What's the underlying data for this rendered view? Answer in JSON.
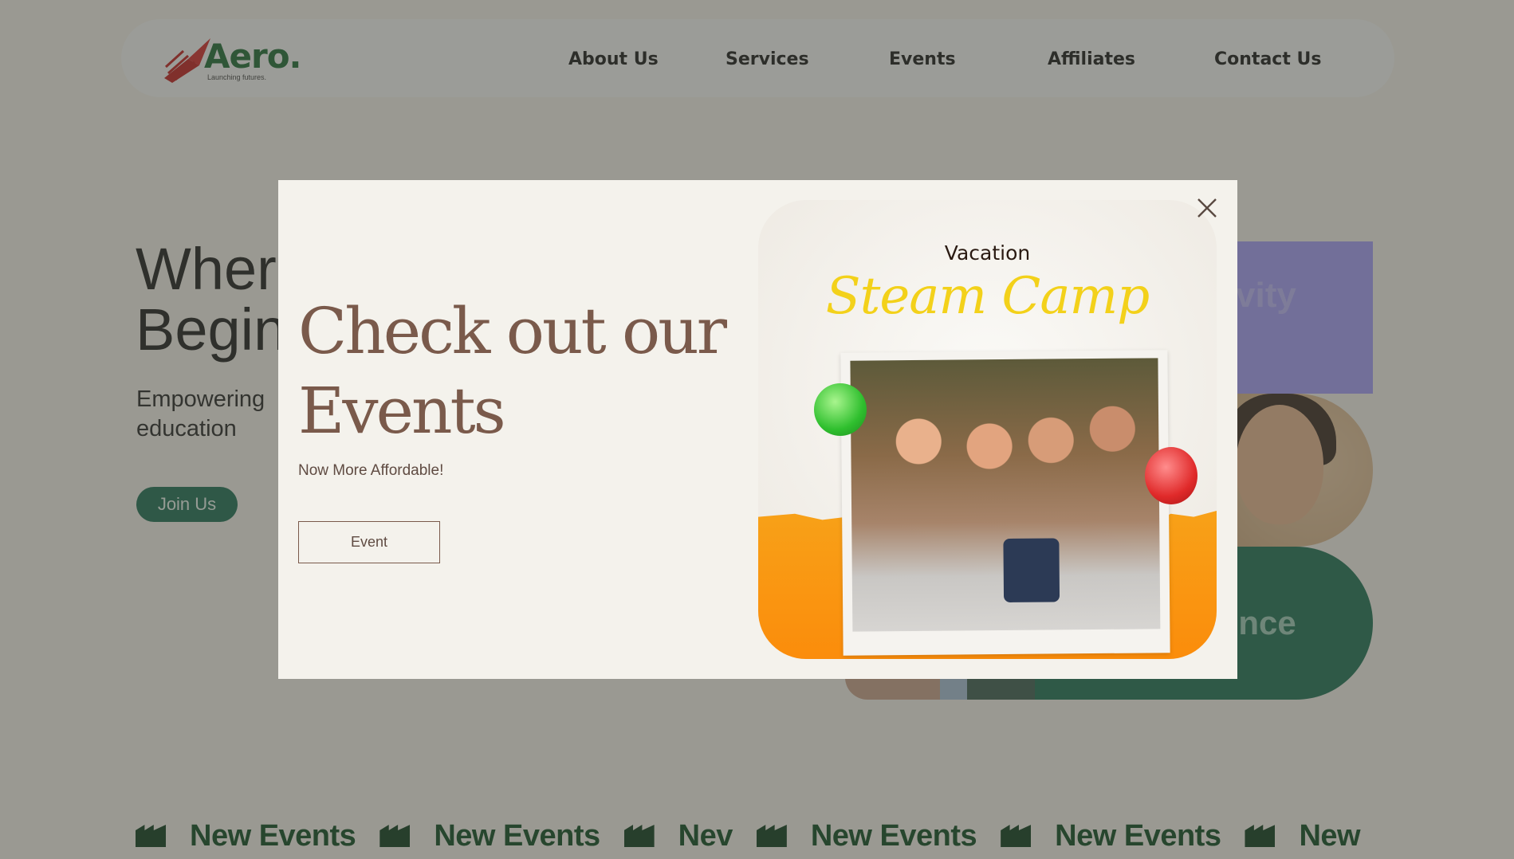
{
  "nav": {
    "logo_text": "Aero.",
    "logo_tagline": "Launching futures.",
    "links": [
      "About Us",
      "Services",
      "Events",
      "Affiliates",
      "Contact Us"
    ]
  },
  "hero": {
    "title_line1": "Where",
    "title_line2": "Begin",
    "subtitle_line1": "Empowering",
    "subtitle_line2": "education",
    "cta_label": "Join Us",
    "tile_purple_text": "vity",
    "tile_green_text": "ence"
  },
  "marquee": {
    "items": [
      "New Events",
      "New Events",
      "Nev",
      "New Events",
      "New Events",
      "New"
    ]
  },
  "modal": {
    "title_line1": "Check out our",
    "title_line2": "Events",
    "subtitle": "Now More Affordable!",
    "button_label": "Event",
    "poster": {
      "heading": "Vacation",
      "script_title": "Steam Camp"
    }
  },
  "colors": {
    "brand_green": "#1f6b34",
    "cta_green": "#1f7155",
    "modal_text": "#7a5a4b",
    "poster_orange": "#fb8c0b",
    "poster_script_yellow": "#f3d11a",
    "tile_purple": "#a59cf8"
  },
  "icons": {
    "close": "close-icon",
    "logo_mark": "rocket-logo-icon",
    "marquee": "clapperboard-icon"
  }
}
